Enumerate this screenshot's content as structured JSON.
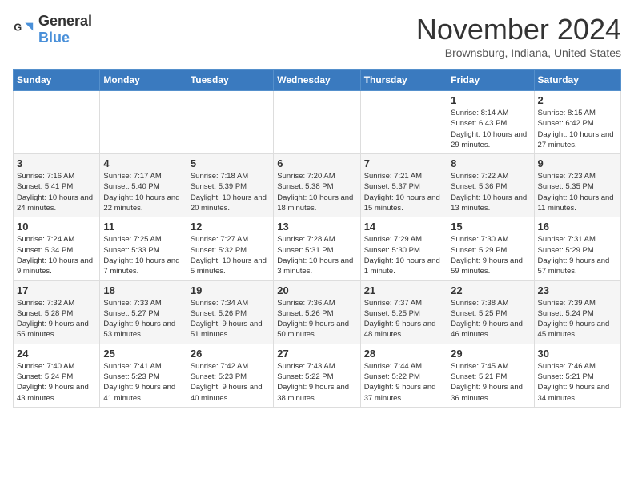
{
  "header": {
    "logo": {
      "general": "General",
      "blue": "Blue"
    },
    "title": "November 2024",
    "location": "Brownsburg, Indiana, United States"
  },
  "weekdays": [
    "Sunday",
    "Monday",
    "Tuesday",
    "Wednesday",
    "Thursday",
    "Friday",
    "Saturday"
  ],
  "weeks": [
    [
      {
        "day": "",
        "info": ""
      },
      {
        "day": "",
        "info": ""
      },
      {
        "day": "",
        "info": ""
      },
      {
        "day": "",
        "info": ""
      },
      {
        "day": "",
        "info": ""
      },
      {
        "day": "1",
        "info": "Sunrise: 8:14 AM\nSunset: 6:43 PM\nDaylight: 10 hours and 29 minutes."
      },
      {
        "day": "2",
        "info": "Sunrise: 8:15 AM\nSunset: 6:42 PM\nDaylight: 10 hours and 27 minutes."
      }
    ],
    [
      {
        "day": "3",
        "info": "Sunrise: 7:16 AM\nSunset: 5:41 PM\nDaylight: 10 hours and 24 minutes."
      },
      {
        "day": "4",
        "info": "Sunrise: 7:17 AM\nSunset: 5:40 PM\nDaylight: 10 hours and 22 minutes."
      },
      {
        "day": "5",
        "info": "Sunrise: 7:18 AM\nSunset: 5:39 PM\nDaylight: 10 hours and 20 minutes."
      },
      {
        "day": "6",
        "info": "Sunrise: 7:20 AM\nSunset: 5:38 PM\nDaylight: 10 hours and 18 minutes."
      },
      {
        "day": "7",
        "info": "Sunrise: 7:21 AM\nSunset: 5:37 PM\nDaylight: 10 hours and 15 minutes."
      },
      {
        "day": "8",
        "info": "Sunrise: 7:22 AM\nSunset: 5:36 PM\nDaylight: 10 hours and 13 minutes."
      },
      {
        "day": "9",
        "info": "Sunrise: 7:23 AM\nSunset: 5:35 PM\nDaylight: 10 hours and 11 minutes."
      }
    ],
    [
      {
        "day": "10",
        "info": "Sunrise: 7:24 AM\nSunset: 5:34 PM\nDaylight: 10 hours and 9 minutes."
      },
      {
        "day": "11",
        "info": "Sunrise: 7:25 AM\nSunset: 5:33 PM\nDaylight: 10 hours and 7 minutes."
      },
      {
        "day": "12",
        "info": "Sunrise: 7:27 AM\nSunset: 5:32 PM\nDaylight: 10 hours and 5 minutes."
      },
      {
        "day": "13",
        "info": "Sunrise: 7:28 AM\nSunset: 5:31 PM\nDaylight: 10 hours and 3 minutes."
      },
      {
        "day": "14",
        "info": "Sunrise: 7:29 AM\nSunset: 5:30 PM\nDaylight: 10 hours and 1 minute."
      },
      {
        "day": "15",
        "info": "Sunrise: 7:30 AM\nSunset: 5:29 PM\nDaylight: 9 hours and 59 minutes."
      },
      {
        "day": "16",
        "info": "Sunrise: 7:31 AM\nSunset: 5:29 PM\nDaylight: 9 hours and 57 minutes."
      }
    ],
    [
      {
        "day": "17",
        "info": "Sunrise: 7:32 AM\nSunset: 5:28 PM\nDaylight: 9 hours and 55 minutes."
      },
      {
        "day": "18",
        "info": "Sunrise: 7:33 AM\nSunset: 5:27 PM\nDaylight: 9 hours and 53 minutes."
      },
      {
        "day": "19",
        "info": "Sunrise: 7:34 AM\nSunset: 5:26 PM\nDaylight: 9 hours and 51 minutes."
      },
      {
        "day": "20",
        "info": "Sunrise: 7:36 AM\nSunset: 5:26 PM\nDaylight: 9 hours and 50 minutes."
      },
      {
        "day": "21",
        "info": "Sunrise: 7:37 AM\nSunset: 5:25 PM\nDaylight: 9 hours and 48 minutes."
      },
      {
        "day": "22",
        "info": "Sunrise: 7:38 AM\nSunset: 5:25 PM\nDaylight: 9 hours and 46 minutes."
      },
      {
        "day": "23",
        "info": "Sunrise: 7:39 AM\nSunset: 5:24 PM\nDaylight: 9 hours and 45 minutes."
      }
    ],
    [
      {
        "day": "24",
        "info": "Sunrise: 7:40 AM\nSunset: 5:24 PM\nDaylight: 9 hours and 43 minutes."
      },
      {
        "day": "25",
        "info": "Sunrise: 7:41 AM\nSunset: 5:23 PM\nDaylight: 9 hours and 41 minutes."
      },
      {
        "day": "26",
        "info": "Sunrise: 7:42 AM\nSunset: 5:23 PM\nDaylight: 9 hours and 40 minutes."
      },
      {
        "day": "27",
        "info": "Sunrise: 7:43 AM\nSunset: 5:22 PM\nDaylight: 9 hours and 38 minutes."
      },
      {
        "day": "28",
        "info": "Sunrise: 7:44 AM\nSunset: 5:22 PM\nDaylight: 9 hours and 37 minutes."
      },
      {
        "day": "29",
        "info": "Sunrise: 7:45 AM\nSunset: 5:21 PM\nDaylight: 9 hours and 36 minutes."
      },
      {
        "day": "30",
        "info": "Sunrise: 7:46 AM\nSunset: 5:21 PM\nDaylight: 9 hours and 34 minutes."
      }
    ]
  ]
}
